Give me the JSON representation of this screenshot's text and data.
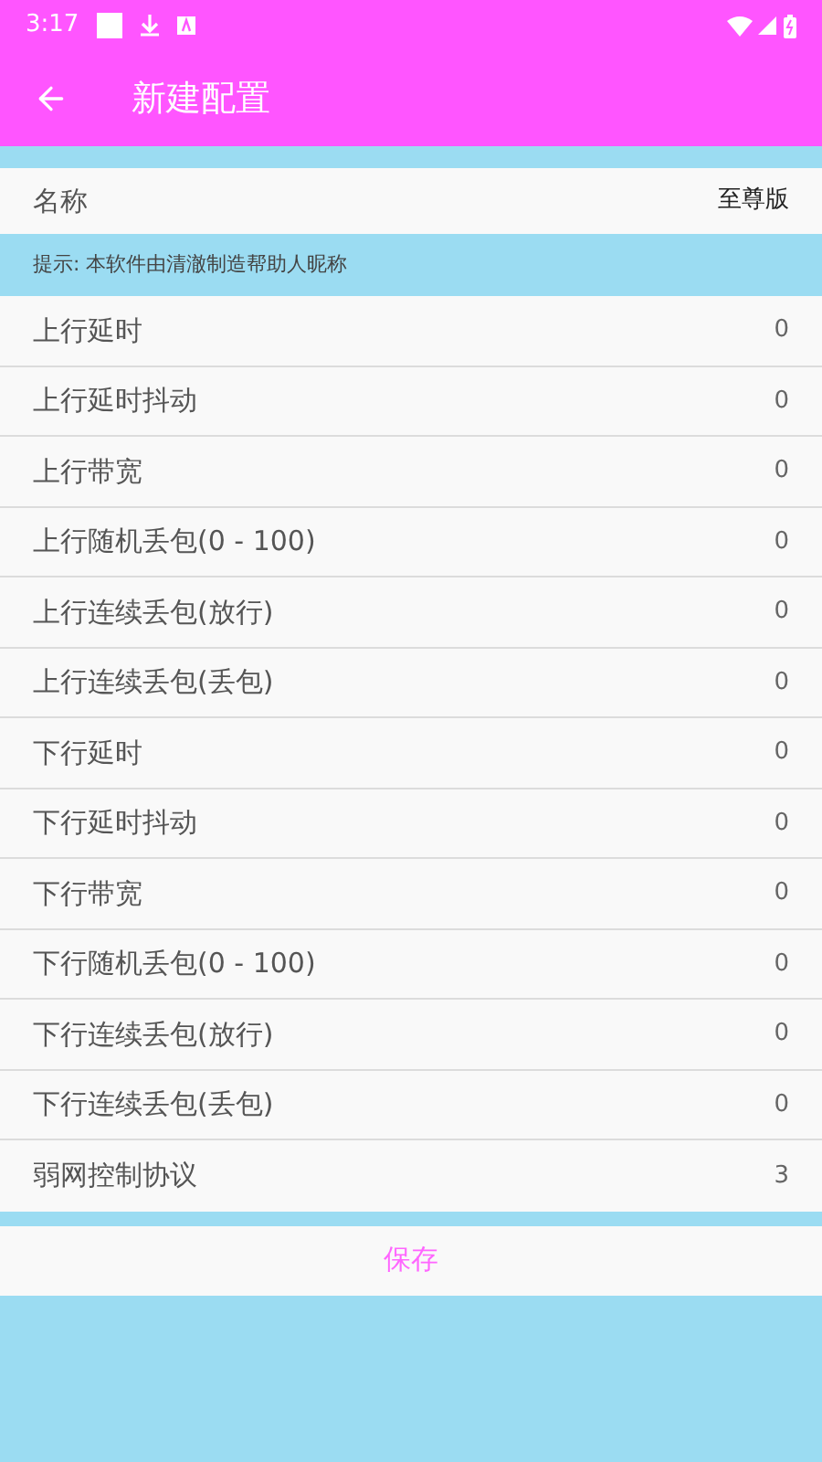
{
  "status_bar": {
    "time": "3:17"
  },
  "app_bar": {
    "title": "新建配置"
  },
  "name_row": {
    "label": "名称",
    "value": "至尊版"
  },
  "hint": "提示: 本软件由清澈制造帮助人昵称",
  "settings": [
    {
      "label": "上行延时",
      "value": "0"
    },
    {
      "label": "上行延时抖动",
      "value": "0"
    },
    {
      "label": "上行带宽",
      "value": "0"
    },
    {
      "label": "上行随机丢包(0 - 100)",
      "value": "0"
    },
    {
      "label": "上行连续丢包(放行)",
      "value": "0"
    },
    {
      "label": "上行连续丢包(丢包)",
      "value": "0"
    },
    {
      "label": "下行延时",
      "value": "0"
    },
    {
      "label": "下行延时抖动",
      "value": "0"
    },
    {
      "label": "下行带宽",
      "value": "0"
    },
    {
      "label": "下行随机丢包(0 - 100)",
      "value": "0"
    },
    {
      "label": "下行连续丢包(放行)",
      "value": "0"
    },
    {
      "label": "下行连续丢包(丢包)",
      "value": "0"
    },
    {
      "label": "弱网控制协议",
      "value": "3"
    }
  ],
  "save_button": "保存"
}
